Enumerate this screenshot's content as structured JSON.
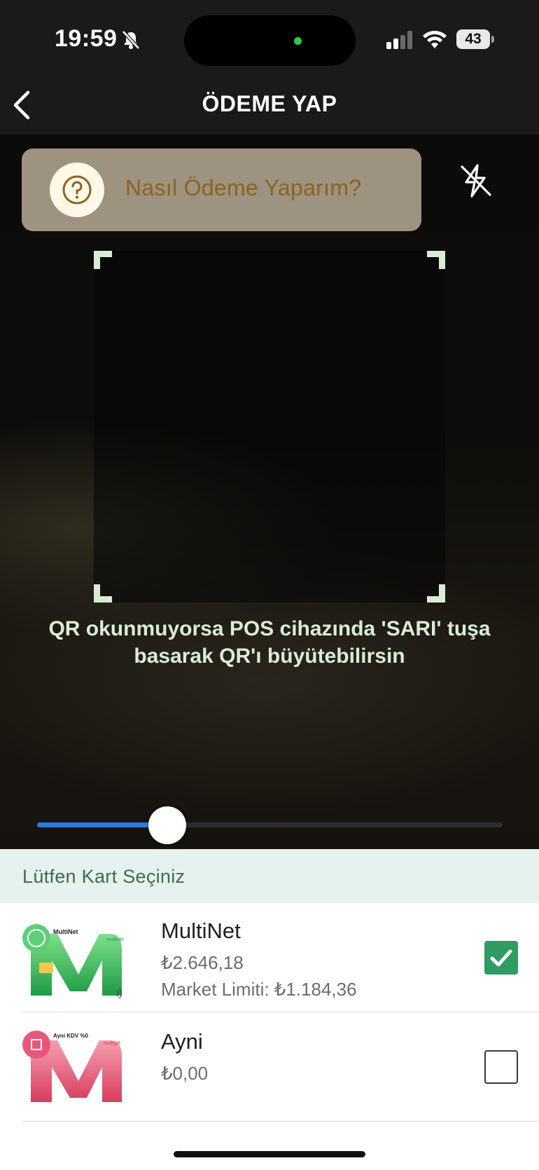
{
  "status_bar": {
    "time": "19:59",
    "battery": "43"
  },
  "header": {
    "title": "ÖDEME YAP"
  },
  "camera": {
    "help_text": "Nasıl Ödeme Yaparım?",
    "hint": "QR okunmuyorsa POS cihazında 'SARI' tuşa basarak QR'ı büyütebilirsin",
    "zoom_level": 0.28
  },
  "card_section": {
    "title": "Lütfen Kart Seçiniz",
    "cards": [
      {
        "name": "MultiNet",
        "balance": "₺2.646,18",
        "limit": "Market Limiti: ₺1.184,36",
        "image_label": "MultiNet",
        "image_brand": "multinet",
        "selected": true
      },
      {
        "name": "Ayni",
        "balance": "₺0,00",
        "image_label": "Ayni KDV %0",
        "image_brand": "multigift",
        "selected": false
      }
    ]
  },
  "colors": {
    "accent_green": "#2e9c63",
    "frame_corner": "#d9ecd6",
    "slider_blue": "#2a7ce8",
    "help_card": "#9e9280"
  }
}
